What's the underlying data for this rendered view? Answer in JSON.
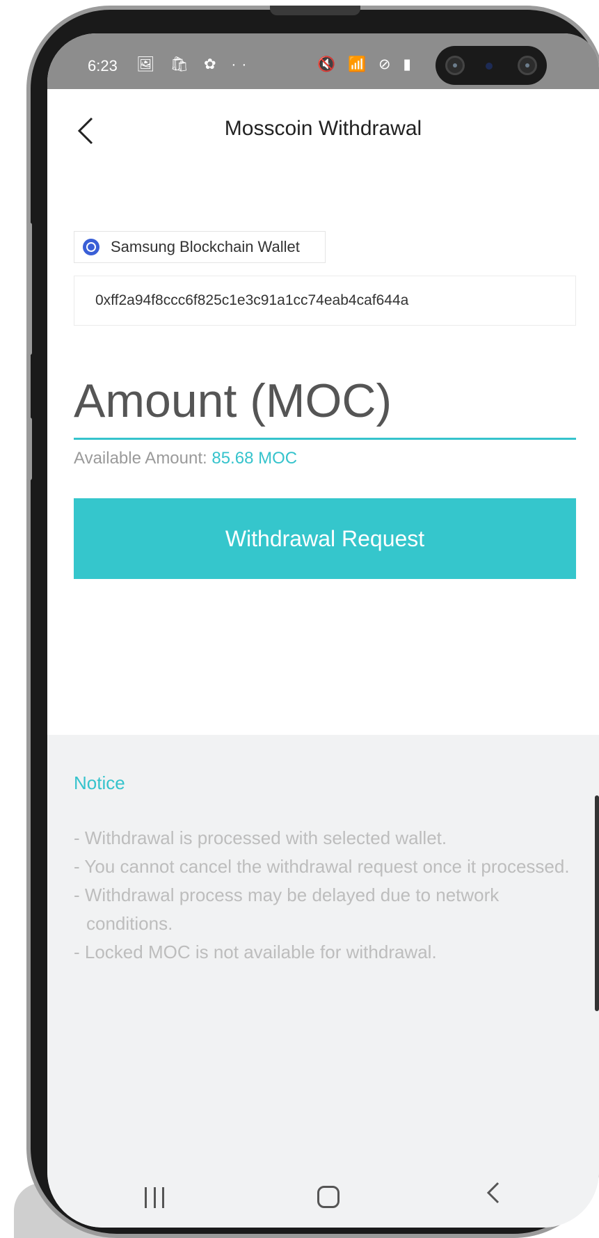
{
  "status_bar": {
    "time": "6:23",
    "left_icons": "🖼 🛍 ✿ ··",
    "right_icons": "🔇 📶 ⊘ ▮"
  },
  "header": {
    "back_icon": "chevron-left-icon",
    "title": "Mosscoin Withdrawal"
  },
  "wallet": {
    "label": "Samsung Blockchain Wallet",
    "address": "0xff2a94f8ccc6f825c1e3c91a1cc74eab4caf644a"
  },
  "amount": {
    "placeholder": "Amount (MOC)",
    "available_label": "Available Amount: ",
    "available_value": "85.68 MOC"
  },
  "action": {
    "button_label": "Withdrawal Request"
  },
  "notice": {
    "title": "Notice",
    "items": [
      "Withdrawal is processed with selected wallet.",
      "You cannot cancel the withdrawal request once it processed.",
      "Withdrawal process may be delayed due to network conditions.",
      "Locked MOC is not available for withdrawal."
    ]
  },
  "navigation": {
    "recent_icon": "recent-apps-icon",
    "home_icon": "home-icon",
    "back_icon": "back-icon"
  },
  "colors": {
    "accent": "#35c6cc",
    "status_bar": "#8d8d8d",
    "notice_bg": "#f1f2f3"
  }
}
